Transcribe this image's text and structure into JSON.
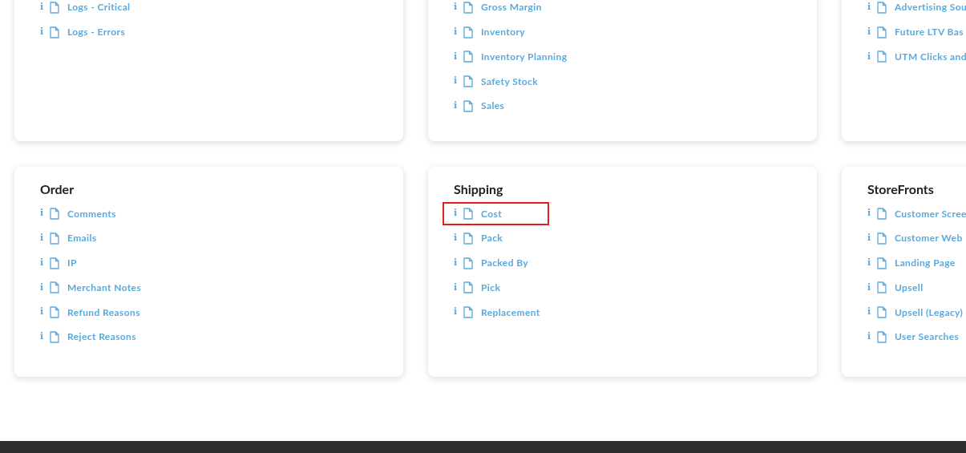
{
  "top_cards": [
    {
      "items": [
        {
          "info": "i",
          "label": "Logs - Critical",
          "highlighted": false
        },
        {
          "info": "i",
          "label": "Logs - Errors",
          "highlighted": false
        }
      ]
    },
    {
      "items": [
        {
          "info": "i",
          "label": "Gross Margin",
          "highlighted": false
        },
        {
          "info": "i",
          "label": "Inventory",
          "highlighted": false
        },
        {
          "info": "i",
          "label": "Inventory Planning",
          "highlighted": false
        },
        {
          "info": "i",
          "label": "Safety Stock",
          "highlighted": false
        },
        {
          "info": "i",
          "label": "Sales",
          "highlighted": false
        }
      ]
    },
    {
      "items": [
        {
          "info": "i",
          "label": "Advertising Sou",
          "highlighted": false
        },
        {
          "info": "i",
          "label": "Future LTV Bas",
          "highlighted": false
        },
        {
          "info": "i",
          "label": "UTM Clicks and",
          "highlighted": false
        }
      ]
    }
  ],
  "cards": [
    {
      "title": "Order",
      "items": [
        {
          "info": "i",
          "label": "Comments",
          "highlighted": false
        },
        {
          "info": "i",
          "label": "Emails",
          "highlighted": false
        },
        {
          "info": "i",
          "label": "IP",
          "highlighted": false
        },
        {
          "info": "i",
          "label": "Merchant Notes",
          "highlighted": false
        },
        {
          "info": "i",
          "label": "Refund Reasons",
          "highlighted": false
        },
        {
          "info": "i",
          "label": "Reject Reasons",
          "highlighted": false
        }
      ]
    },
    {
      "title": "Shipping",
      "items": [
        {
          "info": "i",
          "label": "Cost",
          "highlighted": true
        },
        {
          "info": "i",
          "label": "Pack",
          "highlighted": false
        },
        {
          "info": "i",
          "label": "Packed By",
          "highlighted": false
        },
        {
          "info": "i",
          "label": "Pick",
          "highlighted": false
        },
        {
          "info": "i",
          "label": "Replacement",
          "highlighted": false
        }
      ]
    },
    {
      "title": "StoreFronts",
      "items": [
        {
          "info": "i",
          "label": "Customer Scree",
          "highlighted": false
        },
        {
          "info": "i",
          "label": "Customer Web",
          "highlighted": false
        },
        {
          "info": "i",
          "label": "Landing Page",
          "highlighted": false
        },
        {
          "info": "i",
          "label": "Upsell",
          "highlighted": false
        },
        {
          "info": "i",
          "label": "Upsell (Legacy)",
          "highlighted": false
        },
        {
          "info": "i",
          "label": "User Searches",
          "highlighted": false
        }
      ]
    }
  ]
}
